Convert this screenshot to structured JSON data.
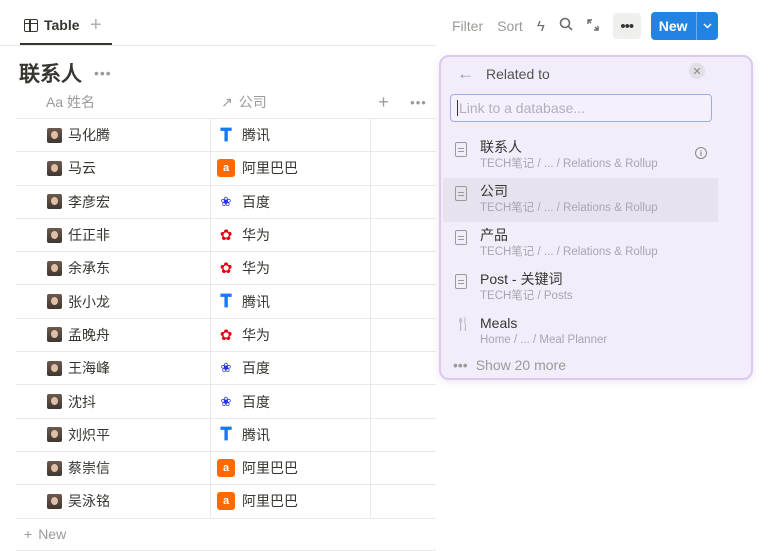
{
  "tab": {
    "label": "Table"
  },
  "toolbar": {
    "filter": "Filter",
    "sort": "Sort",
    "new_label": "New"
  },
  "title": "联系人",
  "columns": {
    "name": "Aa 姓名",
    "company": "公司"
  },
  "rows": [
    {
      "name": "马化腾",
      "company": "腾讯",
      "logo": "tencent"
    },
    {
      "name": "马云",
      "company": "阿里巴巴",
      "logo": "alibaba"
    },
    {
      "name": "李彦宏",
      "company": "百度",
      "logo": "baidu"
    },
    {
      "name": "任正非",
      "company": "华为",
      "logo": "huawei"
    },
    {
      "name": "余承东",
      "company": "华为",
      "logo": "huawei"
    },
    {
      "name": "张小龙",
      "company": "腾讯",
      "logo": "tencent"
    },
    {
      "name": "孟晚舟",
      "company": "华为",
      "logo": "huawei"
    },
    {
      "name": "王海峰",
      "company": "百度",
      "logo": "baidu"
    },
    {
      "name": "沈抖",
      "company": "百度",
      "logo": "baidu"
    },
    {
      "name": "刘炽平",
      "company": "腾讯",
      "logo": "tencent"
    },
    {
      "name": "蔡崇信",
      "company": "阿里巴巴",
      "logo": "alibaba"
    },
    {
      "name": "吴泳铭",
      "company": "阿里巴巴",
      "logo": "alibaba"
    }
  ],
  "new_row_label": "New",
  "popup": {
    "title": "Related to",
    "search_placeholder": "Link to a database...",
    "items": [
      {
        "title": "联系人",
        "sub": "TECH笔记 / ... / Relations & Rollup"
      },
      {
        "title": "公司",
        "sub": "TECH笔记 / ... / Relations & Rollup"
      },
      {
        "title": "产品",
        "sub": "TECH笔记 / ... / Relations & Rollup"
      },
      {
        "title": "Post - 关键词",
        "sub": "TECH笔记 / Posts"
      },
      {
        "title": "Meals",
        "sub": "Home / ... / Meal Planner"
      }
    ],
    "show_more": "Show 20 more"
  },
  "colors": {
    "accent": "#2383e2",
    "popup_bg": "#f3ecfb",
    "popup_border": "#dcc9f1"
  }
}
